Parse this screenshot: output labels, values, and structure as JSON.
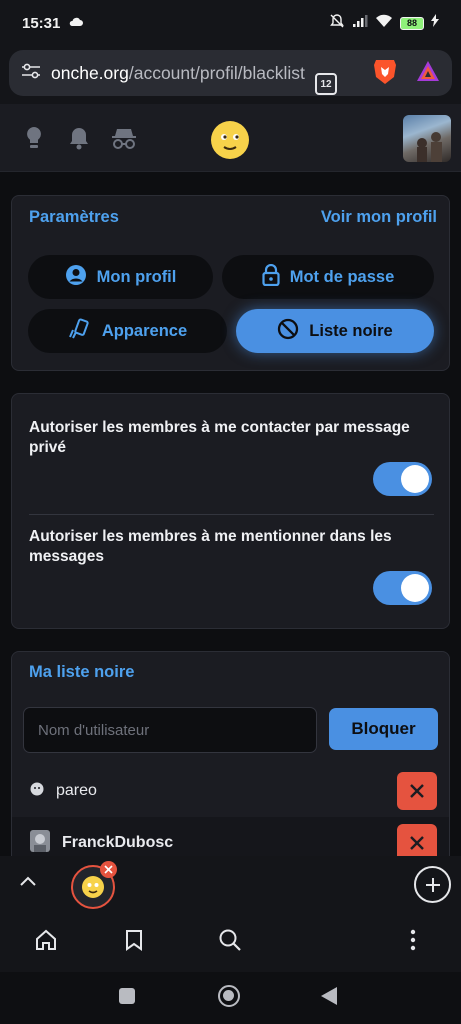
{
  "status": {
    "time": "15:31",
    "battery": "88",
    "icons": [
      "cloud-icon",
      "bell-off-icon",
      "signal-icon",
      "wifi-icon",
      "battery-icon",
      "charging-icon"
    ]
  },
  "browser": {
    "url_host": "onche.org",
    "url_path": "/account/profil/blacklist",
    "tab_count": "12"
  },
  "settings": {
    "title": "Paramètres",
    "view_profile": "Voir mon profil",
    "buttons": {
      "profile": "Mon profil",
      "password": "Mot de passe",
      "appearance": "Apparence",
      "blacklist": "Liste noire"
    }
  },
  "preferences": {
    "private_message": "Autoriser les membres à me contacter par message privé",
    "mention": "Autoriser les membres à me mentionner dans les messages",
    "private_message_enabled": true,
    "mention_enabled": true
  },
  "blacklist": {
    "title": "Ma liste noire",
    "input_placeholder": "Nom d'utilisateur",
    "block_label": "Bloquer",
    "users": [
      {
        "name": "pareo"
      },
      {
        "name": "FranckDubosc"
      }
    ]
  },
  "colors": {
    "accent": "#4a90e2",
    "link": "#4ea1ee",
    "danger": "#e5533f",
    "card": "#1b1c22",
    "background": "#0d0e11"
  }
}
